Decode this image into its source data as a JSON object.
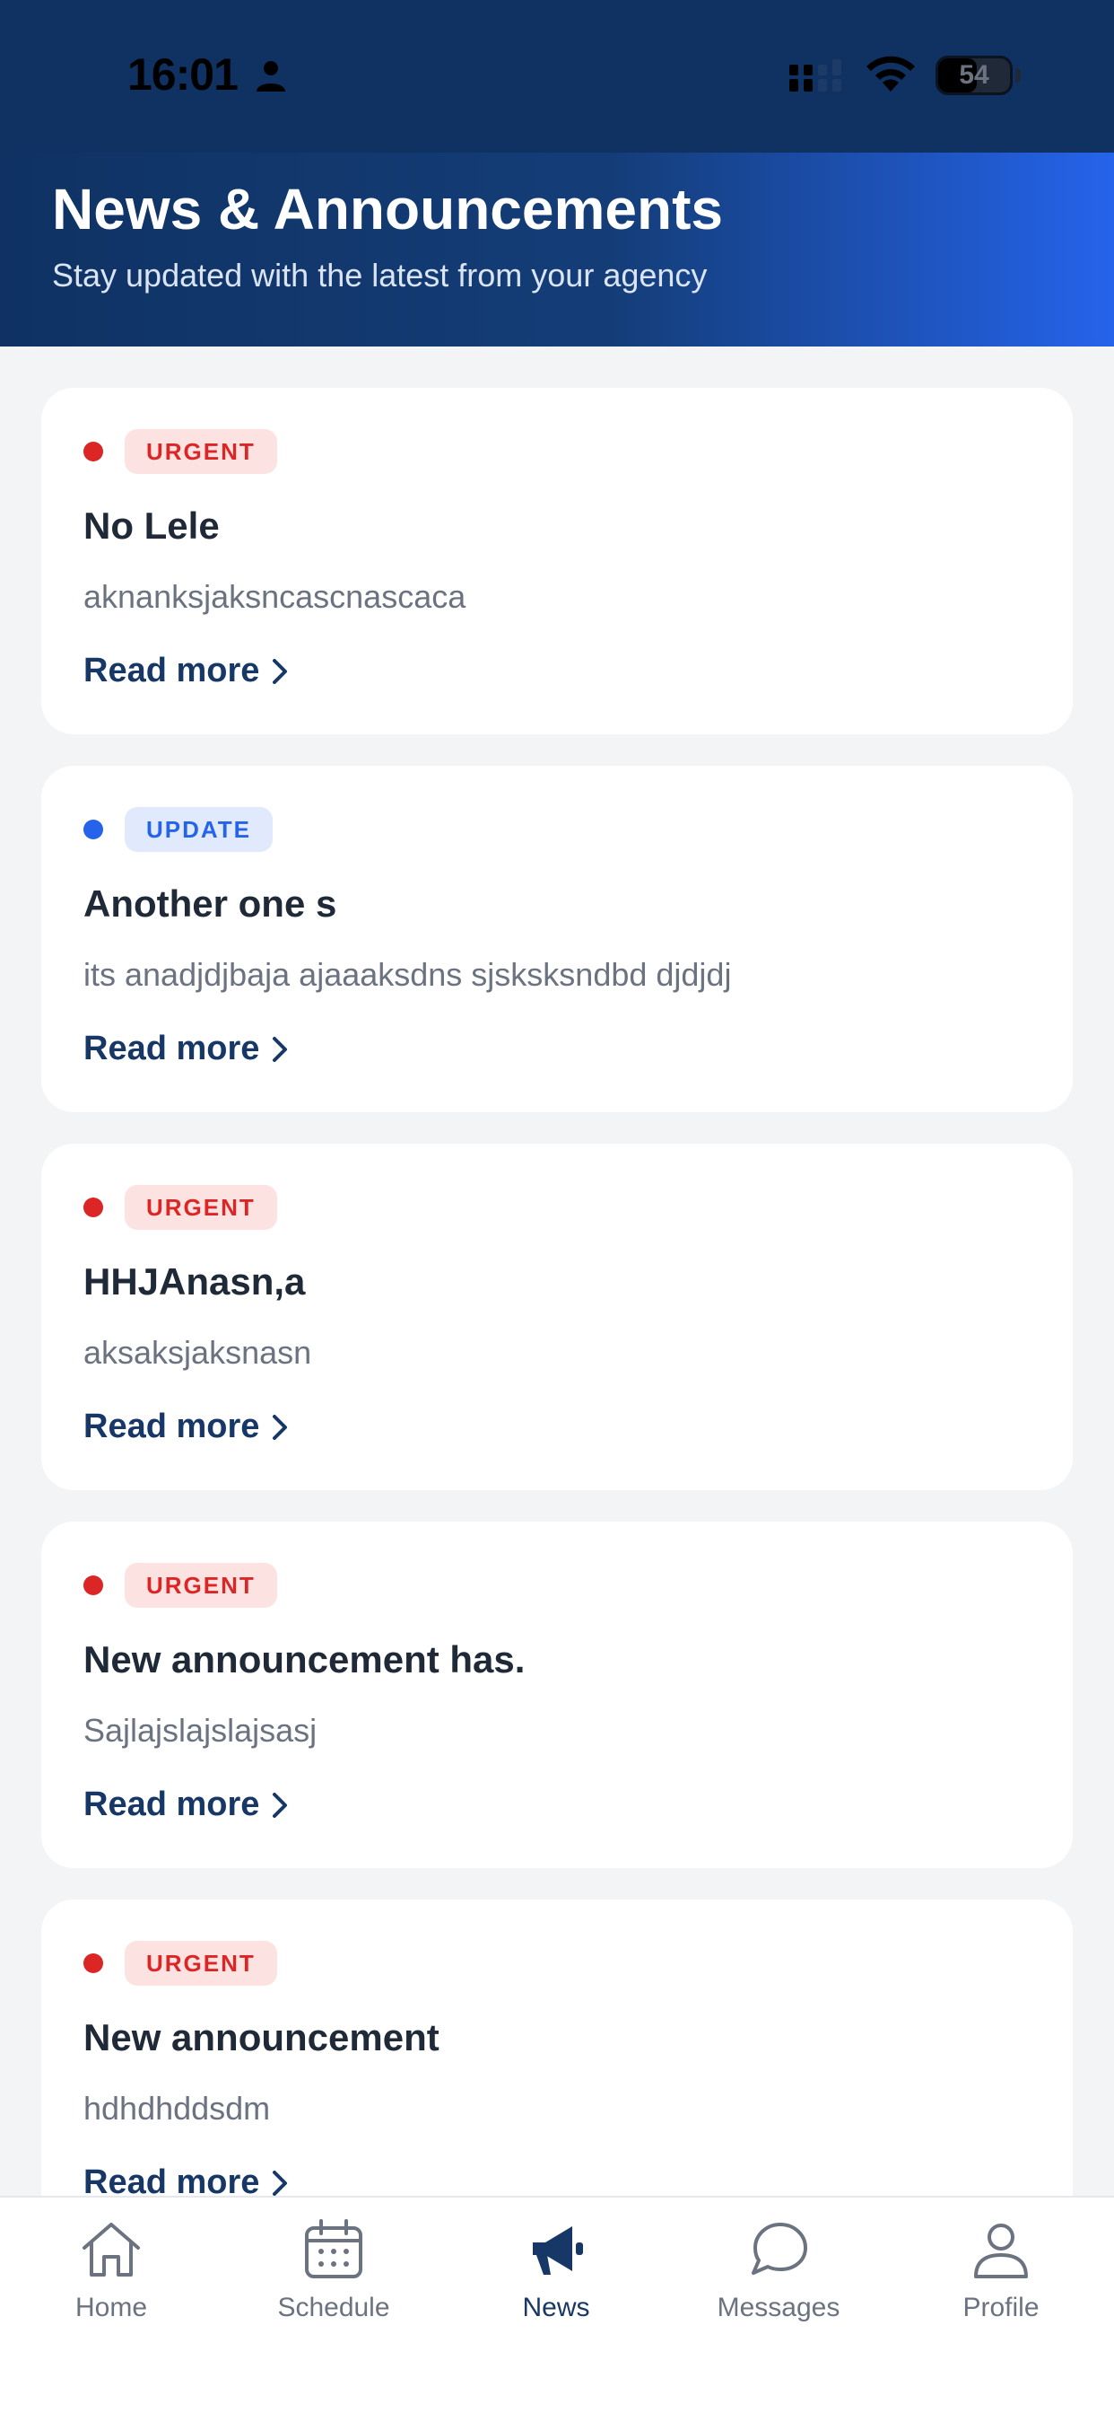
{
  "status_bar": {
    "time": "16:01",
    "battery_level": "54",
    "battery_fraction": 0.54
  },
  "header": {
    "title": "News & Announcements",
    "subtitle": "Stay updated with the latest from your agency"
  },
  "announcements": [
    {
      "badge": "URGENT",
      "type": "urgent",
      "title": "No Lele",
      "body": "aknanksjaksncascnascaca",
      "link": "Read more"
    },
    {
      "badge": "UPDATE",
      "type": "update",
      "title": "Another one s",
      "body": "its anadjdjbaja ajaaaksdns sjsksksndbd djdjdj",
      "link": "Read more"
    },
    {
      "badge": "URGENT",
      "type": "urgent",
      "title": "HHJAnasn,a",
      "body": "aksaksjaksnasn",
      "link": "Read more"
    },
    {
      "badge": "URGENT",
      "type": "urgent",
      "title": "New announcement has.",
      "body": "Sajlajslajslajsasj",
      "link": "Read more"
    },
    {
      "badge": "URGENT",
      "type": "urgent",
      "title": "New announcement",
      "body": "hdhdhddsdm",
      "link": "Read more"
    }
  ],
  "tabs": [
    {
      "label": "Home",
      "icon": "home-icon",
      "active": false
    },
    {
      "label": "Schedule",
      "icon": "calendar-icon",
      "active": false
    },
    {
      "label": "News",
      "icon": "megaphone-icon",
      "active": true
    },
    {
      "label": "Messages",
      "icon": "chat-bubble-icon",
      "active": false
    },
    {
      "label": "Profile",
      "icon": "user-icon",
      "active": false
    }
  ],
  "colors": {
    "primary": "#173866",
    "header_dark": "#0f3263",
    "header_accent": "#2563eb",
    "urgent": "#dc2626",
    "urgent_bg": "#fde2e2",
    "update": "#2563eb",
    "update_bg": "#e0eafc",
    "inactive": "#6b7280"
  }
}
